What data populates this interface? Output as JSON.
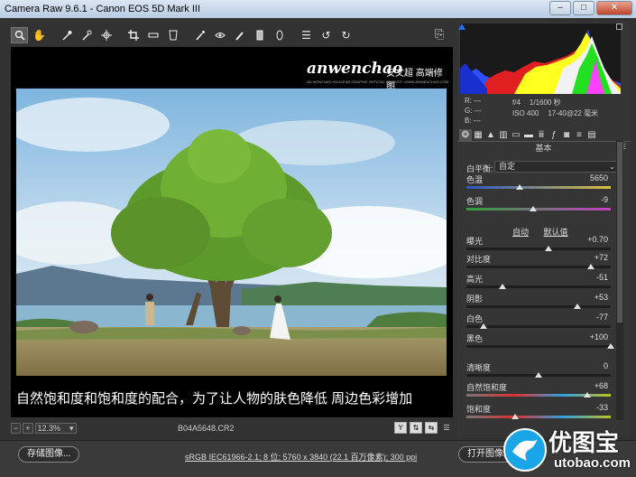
{
  "window": {
    "title": "Camera Raw 9.6.1 -  Canon EOS 5D Mark III",
    "controls": [
      "–",
      "□",
      "✕"
    ]
  },
  "toolbar": {
    "tools": [
      "zoom-icon",
      "hand-icon",
      "white-balance-icon",
      "color-sampler-icon",
      "targeted-adjustment-icon",
      "crop-icon",
      "straighten-icon",
      "transform-icon",
      "spot-removal-icon",
      "red-eye-icon",
      "adjustment-brush-icon",
      "graduated-filter-icon",
      "radial-filter-icon",
      "preferences-icon",
      "rotate-ccw-icon",
      "rotate-cw-icon"
    ]
  },
  "overlay": {
    "brand": "anwenchao",
    "brand_cn": "安文超 高端修图",
    "tagline": "AN WENCHAO HIGH-END GRAPHIC OFFICIAL WEBSITE: WWW.ANWENCHAO.COM"
  },
  "caption": "自然饱和度和饱和度的配合，为了让人物的肤色降低  周边色彩增加",
  "status": {
    "zoom": "12.3%",
    "filename": "B04A5648.CR2"
  },
  "bottom": {
    "save_label": "存储图像...",
    "workflow_text": "sRGB IEC61966-2.1; 8 位; 5760 x 3840 (22.1 百万像素); 300 ppi",
    "open_label": "打开图像"
  },
  "watermark": {
    "cn": "优图宝",
    "url": "utobao.com"
  },
  "readout": {
    "r": "R:  ---",
    "g": "G:  ---",
    "b": "B:  ---",
    "aperture": "f/4",
    "shutter": "1/1600 秒",
    "iso": "ISO 400",
    "lens": "17-40@22 毫米"
  },
  "panel": {
    "title": "基本",
    "wb_label": "白平衡:",
    "wb_value": "自定",
    "auto_label": "自动",
    "default_label": "默认值"
  },
  "sliders": [
    {
      "id": "temperature",
      "label": "色温",
      "value": "5650",
      "pos": 0.37
    },
    {
      "id": "tint",
      "label": "色调",
      "value": "-9",
      "pos": 0.46
    },
    {
      "id": "exposure",
      "label": "曝光",
      "value": "+0.70",
      "pos": 0.57
    },
    {
      "id": "contrast",
      "label": "对比度",
      "value": "+72",
      "pos": 0.86
    },
    {
      "id": "highlights",
      "label": "高光",
      "value": "-51",
      "pos": 0.25
    },
    {
      "id": "shadows",
      "label": "阴影",
      "value": "+53",
      "pos": 0.77
    },
    {
      "id": "whites",
      "label": "白色",
      "value": "-77",
      "pos": 0.12
    },
    {
      "id": "blacks",
      "label": "黑色",
      "value": "+100",
      "pos": 1.0
    },
    {
      "id": "clarity",
      "label": "清晰度",
      "value": "0",
      "pos": 0.5
    },
    {
      "id": "vibrance",
      "label": "自然饱和度",
      "value": "+68",
      "pos": 0.84
    },
    {
      "id": "saturation",
      "label": "饱和度",
      "value": "-33",
      "pos": 0.34
    }
  ],
  "colors": {
    "accent": "#1aa5e6",
    "panel_bg": "#353535"
  }
}
